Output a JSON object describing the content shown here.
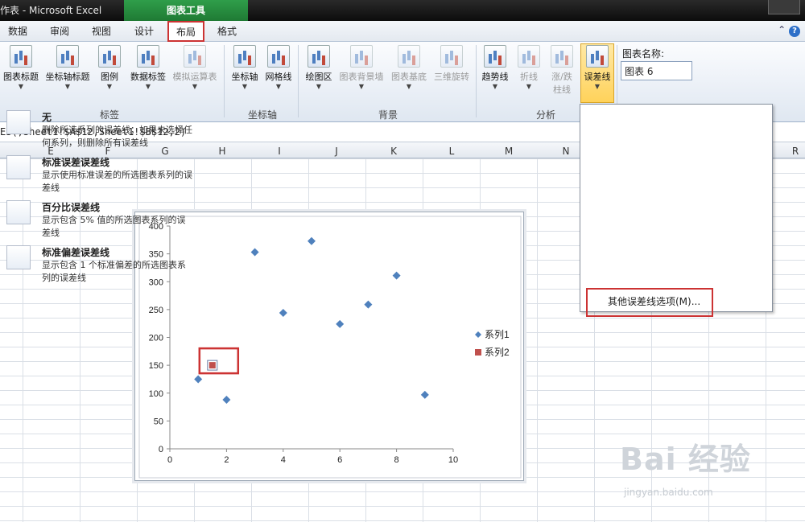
{
  "title_bar": {
    "text": "作表 - Microsoft Excel",
    "context_tab": "图表工具"
  },
  "tabs": [
    "数据",
    "审阅",
    "视图",
    "设计",
    "布局",
    "格式"
  ],
  "active_tab": "布局",
  "ribbon": {
    "buttons": {
      "chart_title": "图表标题",
      "axis_titles": "坐标轴标题",
      "legend": "图例",
      "data_labels": "数据标签",
      "data_table": "模拟运算表",
      "axes": "坐标轴",
      "gridlines": "网格线",
      "plot_area": "绘图区",
      "chart_wall": "图表背景墙",
      "chart_floor": "图表基底",
      "rotation_3d": "三维旋转",
      "trendline": "趋势线",
      "lines": "折线",
      "updown_bars_1": "涨/跌",
      "updown_bars_2": "柱线",
      "error_bars": "误差线"
    },
    "groups": {
      "labels": "标签",
      "axes": "坐标轴",
      "background": "背景",
      "analysis": "分析"
    },
    "chart_name_label": "图表名称:",
    "chart_name_value": "图表 6"
  },
  "formula": "ES(,Sheet1!$A$12,Sheet1!$B$12,2)",
  "columns": [
    "E",
    "F",
    "G",
    "H",
    "I",
    "J",
    "K",
    "L",
    "M",
    "N",
    "R"
  ],
  "menu": {
    "items": [
      {
        "title": "无",
        "desc": "删除所选系列的误差线；如果未选择任何系列，则删除所有误差线"
      },
      {
        "title": "标准误差误差线",
        "desc": "显示使用标准误差的所选图表系列的误差线"
      },
      {
        "title": "百分比误差线",
        "desc": "显示包含 5% 值的所选图表系列的误差线"
      },
      {
        "title": "标准偏差误差线",
        "desc": "显示包含 1 个标准偏差的所选图表系列的误差线"
      }
    ],
    "more": "其他误差线选项(M)..."
  },
  "watermark": {
    "main": "Bai 经验",
    "sub": "jingyan.baidu.com"
  },
  "chart_data": {
    "type": "scatter",
    "xlim": [
      0,
      10
    ],
    "ylim": [
      0,
      400
    ],
    "xticks": [
      "0",
      "2",
      "4",
      "6",
      "8",
      "10"
    ],
    "yticks": [
      "0",
      "50",
      "100",
      "150",
      "200",
      "250",
      "300",
      "350",
      "400"
    ],
    "legend_position": "right",
    "series": [
      {
        "name": "系列1",
        "color": "#4f81bd",
        "marker": "diamond",
        "points": [
          [
            1,
            125
          ],
          [
            2,
            88
          ],
          [
            3,
            353
          ],
          [
            4,
            244
          ],
          [
            5,
            373
          ],
          [
            6,
            224
          ],
          [
            7,
            259
          ],
          [
            8,
            311
          ],
          [
            9,
            97
          ]
        ]
      },
      {
        "name": "系列2",
        "color": "#c0504d",
        "marker": "square",
        "points": [
          [
            1.5,
            150
          ]
        ]
      }
    ]
  }
}
